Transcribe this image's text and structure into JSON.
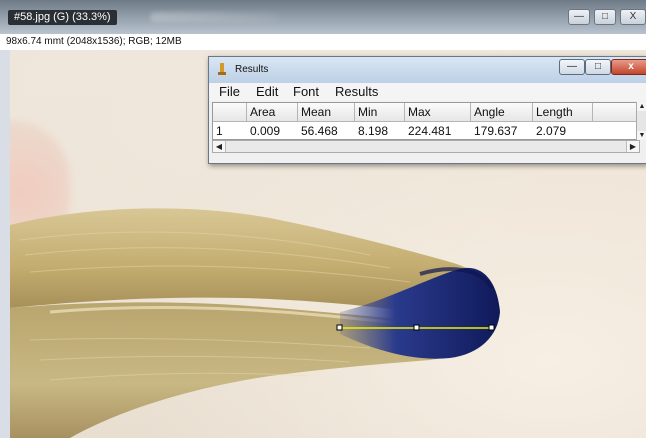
{
  "image_window": {
    "title": "#58.jpg (G) (33.3%)",
    "info": "98x6.74 mmt (2048x1536); RGB; 12MB",
    "buttons": {
      "minimize": "—",
      "maximize": "□",
      "close": "X"
    }
  },
  "results_window": {
    "title": "Results",
    "buttons": {
      "minimize": "—",
      "maximize": "□",
      "close": "x"
    },
    "menu": [
      "File",
      "Edit",
      "Font",
      "Results"
    ],
    "table": {
      "headers": [
        "",
        "Area",
        "Mean",
        "Min",
        "Max",
        "Angle",
        "Length"
      ],
      "rows": [
        [
          "1",
          "0.009",
          "56.468",
          "8.198",
          "224.481",
          "179.637",
          "2.079"
        ]
      ]
    }
  },
  "colors": {
    "selection_line": "#f0f000",
    "stain_blue": "#1f2a7a",
    "tooth_base": "#c9b47c"
  }
}
